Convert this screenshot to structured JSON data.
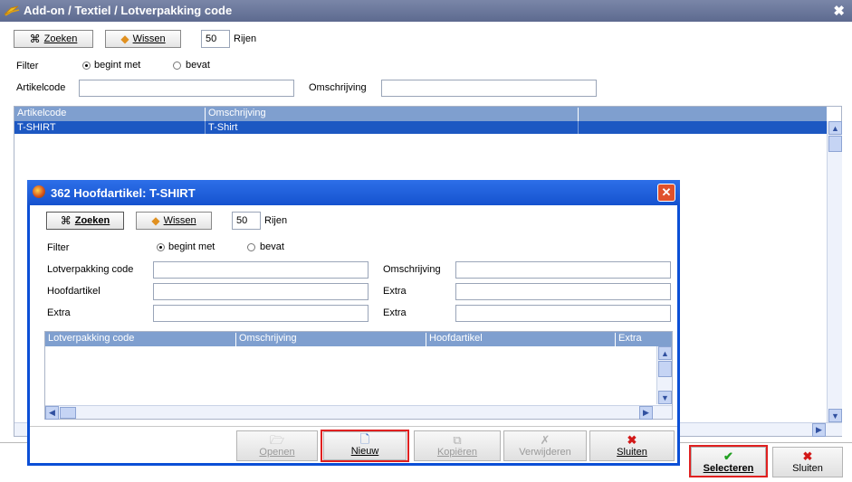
{
  "window": {
    "title": "Add-on / Textiel / Lotverpakking code",
    "close_glyph": "✖"
  },
  "toolbar": {
    "search_label": "Zoeken",
    "clear_label": "Wissen",
    "rows_value": "50",
    "rows_label": "Rijen"
  },
  "filter": {
    "label": "Filter",
    "option_begins": "begint met",
    "option_contains": "bevat",
    "selected": "begint met"
  },
  "fields": {
    "article_code_label": "Artikelcode",
    "description_label": "Omschrijving",
    "article_code_value": "",
    "description_value": ""
  },
  "grid": {
    "columns": [
      "Artikelcode",
      "Omschrijving"
    ],
    "rows": [
      {
        "artikelcode": "T-SHIRT",
        "omschrijving": "T-Shirt"
      }
    ]
  },
  "footer": {
    "select_label": "Selecteren",
    "close_label": "Sluiten"
  },
  "dialog": {
    "title": "362 Hoofdartikel: T-SHIRT",
    "toolbar": {
      "search_label": "Zoeken",
      "clear_label": "Wissen",
      "rows_value": "50",
      "rows_label": "Rijen"
    },
    "filter": {
      "label": "Filter",
      "option_begins": "begint met",
      "option_contains": "bevat"
    },
    "fields": {
      "lot_code_label": "Lotverpakking code",
      "main_article_label": "Hoofdartikel",
      "extra1_label": "Extra",
      "description_label": "Omschrijving",
      "extra2_label": "Extra",
      "extra3_label": "Extra"
    },
    "grid": {
      "columns": [
        "Lotverpakking code",
        "Omschrijving",
        "Hoofdartikel",
        "Extra"
      ]
    },
    "buttons": {
      "open": "Openen",
      "new": "Nieuw",
      "copy": "Kopiëren",
      "delete": "Verwijderen",
      "close": "Sluiten"
    }
  },
  "colors": {
    "accent_blue": "#0b4fd6",
    "grid_header": "#7f9fcf",
    "selection": "#1d58c2",
    "highlight_red": "#e02020",
    "ok_green": "#22a022"
  }
}
